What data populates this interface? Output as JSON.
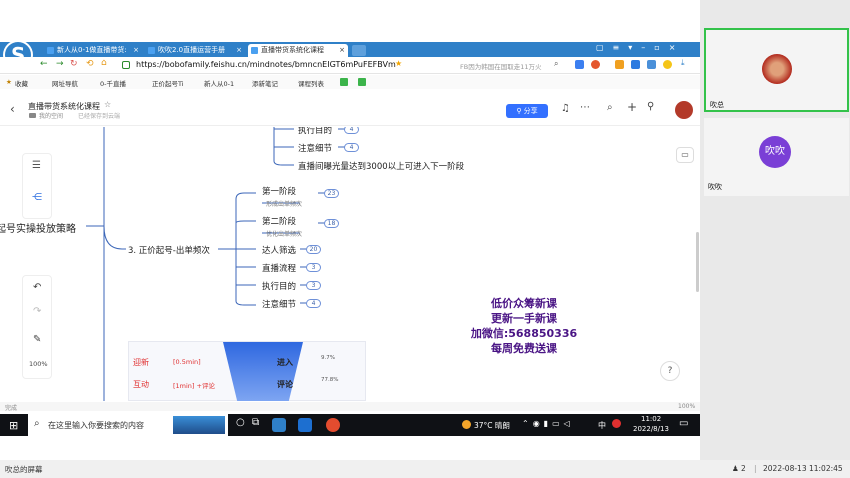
{
  "browser": {
    "tabs": [
      {
        "label": "新人从0-1做直播带货:",
        "active": false
      },
      {
        "label": "吹吹2.0直播运营手册",
        "active": false
      },
      {
        "label": "直播带货系统化课程",
        "active": true
      }
    ],
    "url": "https://bobofamily.feishu.cn/mindnotes/bmncnEIGT6mPuFEFBVm",
    "search_hint": "FB因为韩国在国取走11万火",
    "bookmarks": [
      "收藏",
      "网址导航",
      "0-千直播",
      "正价起号Ti",
      "新人从0-1",
      "添新笔记",
      "课程列表"
    ]
  },
  "doc": {
    "title": "直播带货系统化课程",
    "location": "我的空间",
    "saved": "已经保存到云端",
    "share_label": "分享"
  },
  "mindmap": {
    "root": "起号实操投放策略",
    "branch": "3. 正价起号-出单频次",
    "top_items": [
      {
        "label": "执行目的",
        "count": "4"
      },
      {
        "label": "注意细节",
        "count": "4"
      }
    ],
    "top_note": "直播间曝光量达到3000以上可进入下一阶段",
    "children": [
      {
        "label": "第一阶段",
        "sub": "形成出单频次",
        "count": "23"
      },
      {
        "label": "第二阶段",
        "sub": "优化出单频次",
        "count": "18"
      },
      {
        "label": "达人筛选",
        "sub": "",
        "count": "20"
      },
      {
        "label": "直播流程",
        "sub": "",
        "count": "3"
      },
      {
        "label": "执行目的",
        "sub": "",
        "count": "3"
      },
      {
        "label": "注意细节",
        "sub": "",
        "count": "4"
      }
    ],
    "zoom": "100%"
  },
  "promo": [
    "低价众筹新课",
    "更新一手新课",
    "加微信:568850336",
    "每周免费送课"
  ],
  "funnel": {
    "rows": [
      {
        "label": "迎新",
        "tag": "[0.5min]",
        "action": "进入",
        "pct": "9.7%"
      },
      {
        "label": "互动",
        "tag": "[1min] +评论",
        "action": "评论",
        "pct": "77.8%"
      }
    ]
  },
  "statusbar": {
    "left": "完成",
    "zoom": "100%"
  },
  "taskbar": {
    "search_placeholder": "在这里输入你要搜索的内容",
    "weather": "37°C 晴朗",
    "ime": "中",
    "time": "11:02",
    "date": "2022/8/13"
  },
  "participants": [
    {
      "name": "吹总",
      "active": true
    },
    {
      "name": "吹吹",
      "avatar_text": "吹吹",
      "active": false
    }
  ],
  "bottom": {
    "screen_label": "吹总的屏幕",
    "count": "2",
    "datetime": "2022-08-13 11:02:45"
  },
  "colors": {
    "accent": "#2f80c8",
    "promo": "#4a1585",
    "avatar": "#7a3fd6",
    "tile_border": "#33c24a"
  }
}
